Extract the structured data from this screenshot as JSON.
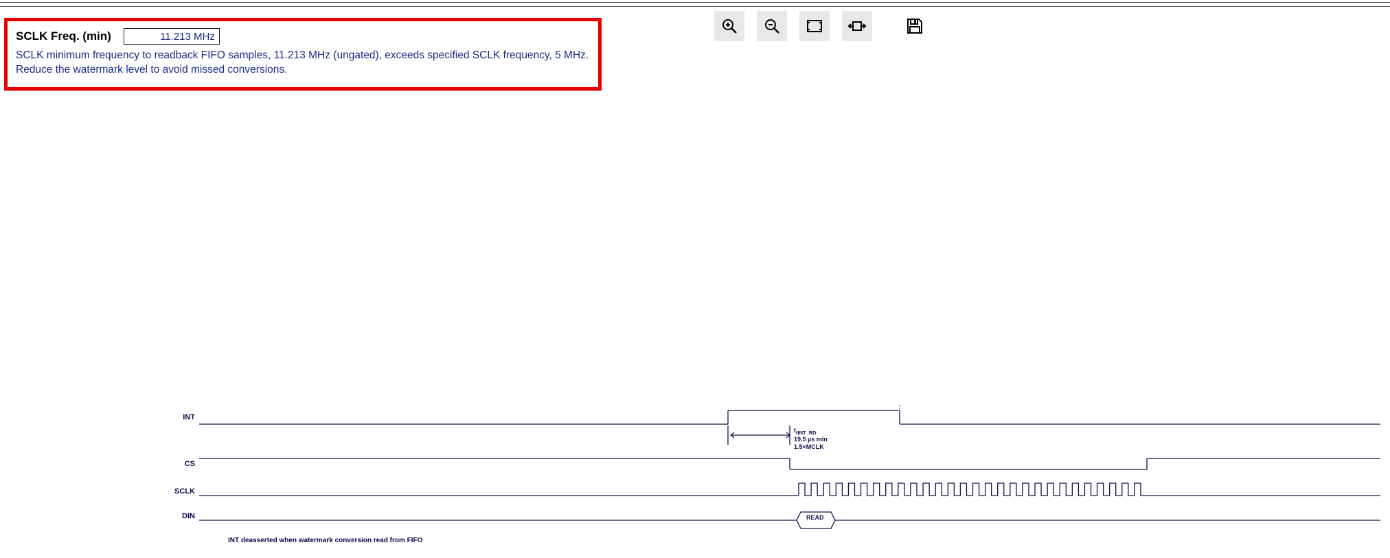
{
  "toolbar": {
    "zoom_in": "zoom-in",
    "zoom_out": "zoom-out",
    "zoom_fit": "zoom-fit",
    "zoom_region": "zoom-region",
    "save": "save"
  },
  "callout": {
    "label": "SCLK Freq. (min)",
    "value": "11.213 MHz",
    "message_line1": "SCLK minimum frequency to readback FIFO samples, 11.213 MHz (ungated), exceeds specified SCLK frequency, 5 MHz.",
    "message_line2": "Reduce the watermark level to avoid missed conversions."
  },
  "diagram": {
    "signals": {
      "int": "INT",
      "cs": "CS",
      "sclk": "SCLK",
      "din": "DIN"
    },
    "annotation": {
      "title": "tINT_RD",
      "line1": "19.5 µs min",
      "line2": "1.5×MCLK"
    },
    "din_payload": "READ",
    "footnote": "INT deasserted when watermark conversion read from FIFO"
  }
}
